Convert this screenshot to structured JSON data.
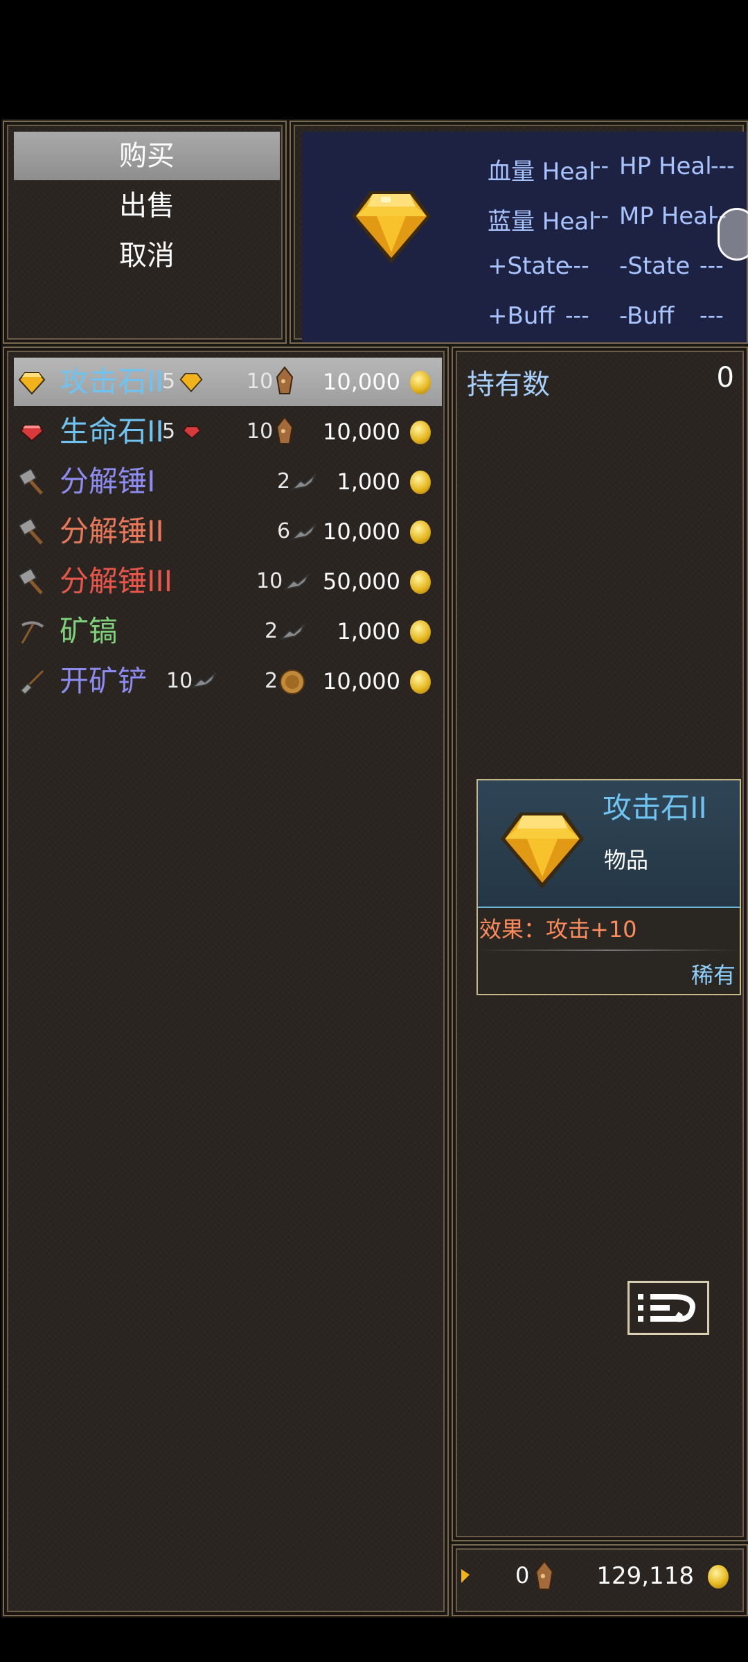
{
  "commands": [
    "购买",
    "出售",
    "取消"
  ],
  "status": {
    "rows": [
      {
        "left": "血量 Heal",
        "left_dash": "--",
        "right": "HP Heal",
        "right_dash": "---"
      },
      {
        "left": "蓝量 Heal",
        "left_dash": "--",
        "right": "MP Heal",
        "right_dash": "--"
      },
      {
        "left": "+State",
        "left_dash": "---",
        "right": "-State",
        "right_dash": "---"
      },
      {
        "left": "+Buff",
        "left_dash": "---",
        "right": "-Buff",
        "right_dash": "---"
      }
    ]
  },
  "shop_items": [
    {
      "name": "攻击石II",
      "color": "#6fc3f0",
      "req1": "5",
      "req2": "10",
      "price": "10,000",
      "icon": "gold-gem-icon"
    },
    {
      "name": "生命石II",
      "color": "#6fc3f0",
      "req1": "5",
      "req2": "10",
      "price": "10,000",
      "icon": "red-gem-icon"
    },
    {
      "name": "分解锤I",
      "color": "#8c8cf0",
      "req1": "",
      "req2": "2",
      "price": "1,000",
      "icon": "hammer-icon"
    },
    {
      "name": "分解锤II",
      "color": "#e8785a",
      "req1": "",
      "req2": "6",
      "price": "10,000",
      "icon": "hammer-icon"
    },
    {
      "name": "分解锤III",
      "color": "#e8564a",
      "req1": "",
      "req2": "10",
      "price": "50,000",
      "icon": "hammer-icon"
    },
    {
      "name": "矿镐",
      "color": "#7fd07a",
      "req1": "",
      "req2": "2",
      "price": "1,000",
      "icon": "pickaxe-icon"
    },
    {
      "name": "开矿铲",
      "color": "#8c8cf0",
      "req1": "10",
      "req2": "2",
      "price": "10,000",
      "icon": "shovel-icon"
    }
  ],
  "info": {
    "own_label": "持有数",
    "own_value": "0",
    "card": {
      "name": "攻击石II",
      "type": "物品",
      "effect": "效果：攻击+10",
      "rarity": "稀有"
    }
  },
  "gold": {
    "ore": "0",
    "amount": "129,118"
  }
}
